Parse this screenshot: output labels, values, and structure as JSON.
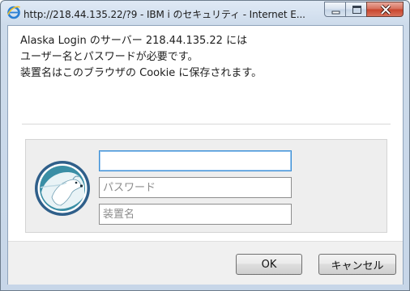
{
  "window": {
    "title": "http://218.44.135.22/?9 - IBM i のセキュリティ - Internet E..."
  },
  "message": {
    "line1": "Alaska Login のサーバー 218.44.135.22 には",
    "line2": "ユーザー名とパスワードが必要です。",
    "line3": "装置名はこのブラウザの Cookie に保存されます。"
  },
  "form": {
    "username": {
      "value": "",
      "placeholder": ""
    },
    "password": {
      "value": "",
      "placeholder": "パスワード"
    },
    "device": {
      "value": "",
      "placeholder": "装置名"
    }
  },
  "buttons": {
    "ok_label": "OK",
    "cancel_label": "キャンセル"
  },
  "icons": {
    "app": "internet-explorer-icon",
    "logo": "polar-bear-logo",
    "minimize": "minimize-icon",
    "maximize": "maximize-icon",
    "close": "close-icon"
  },
  "colors": {
    "focus_border": "#3c8fd6",
    "close_button": "#c7432b",
    "logo_ring": "#2f5f8a"
  }
}
